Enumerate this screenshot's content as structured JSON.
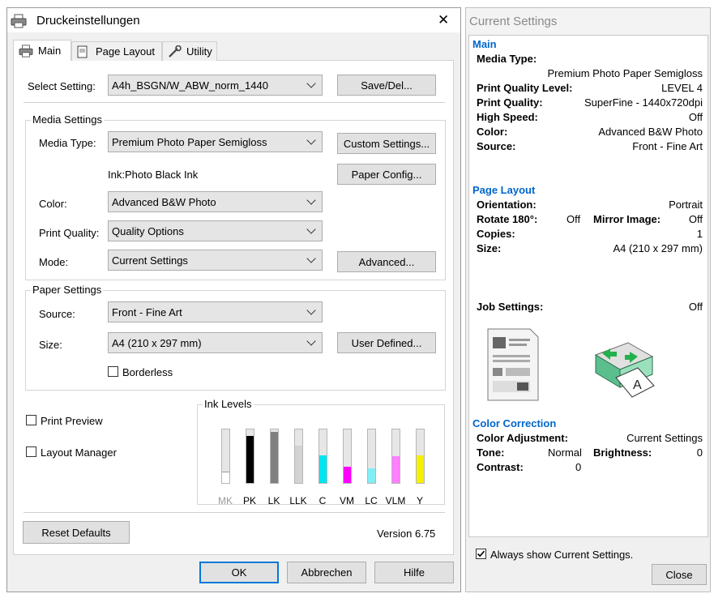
{
  "dialog": {
    "title": "Druckeinstellungen",
    "tabs": [
      "Main",
      "Page Layout",
      "Utility"
    ],
    "select_setting": {
      "label": "Select Setting:",
      "value": "A4h_BSGN/W_ABW_norm_1440",
      "button": "Save/Del..."
    },
    "media_settings": {
      "title": "Media Settings",
      "media_type": {
        "label": "Media Type:",
        "value": "Premium Photo Paper Semigloss",
        "button": "Custom Settings..."
      },
      "ink": {
        "label": "Ink:Photo Black Ink",
        "button": "Paper Config..."
      },
      "color": {
        "label": "Color:",
        "value": "Advanced B&W Photo"
      },
      "print_quality": {
        "label": "Print Quality:",
        "value": "Quality Options"
      },
      "mode": {
        "label": "Mode:",
        "value": "Current Settings",
        "button": "Advanced..."
      }
    },
    "paper_settings": {
      "title": "Paper Settings",
      "source": {
        "label": "Source:",
        "value": "Front - Fine Art"
      },
      "size": {
        "label": "Size:",
        "value": "A4 (210 x 297 mm)",
        "button": "User Defined..."
      },
      "borderless": {
        "label": "Borderless",
        "checked": false
      }
    },
    "print_preview": {
      "label": "Print Preview",
      "checked": false
    },
    "layout_manager": {
      "label": "Layout Manager",
      "checked": false
    },
    "ink_levels": {
      "title": "Ink Levels",
      "inks": [
        {
          "name": "MK",
          "level": 0.2,
          "color": "#ffffff",
          "dim": true
        },
        {
          "name": "PK",
          "level": 0.88,
          "color": "#000000"
        },
        {
          "name": "LK",
          "level": 0.95,
          "color": "#808080"
        },
        {
          "name": "LLK",
          "level": 0.7,
          "color": "#d3d3d3"
        },
        {
          "name": "C",
          "level": 0.52,
          "color": "#00e5f0"
        },
        {
          "name": "VM",
          "level": 0.3,
          "color": "#ff00ff"
        },
        {
          "name": "LC",
          "level": 0.28,
          "color": "#7feef5"
        },
        {
          "name": "VLM",
          "level": 0.5,
          "color": "#ff7fff"
        },
        {
          "name": "Y",
          "level": 0.52,
          "color": "#f5f000"
        }
      ]
    },
    "reset_button": "Reset Defaults",
    "version": "Version 6.75",
    "ok": "OK",
    "cancel": "Abbrechen",
    "help": "Hilfe",
    "close_glyph": "✕"
  },
  "current_settings": {
    "title": "Current Settings",
    "main": {
      "heading": "Main",
      "media_type_key": "Media Type:",
      "media_type_val": "Premium Photo Paper Semigloss",
      "rows": [
        {
          "key": "Print Quality Level:",
          "val": "LEVEL 4"
        },
        {
          "key": "Print Quality:",
          "val": "SuperFine - 1440x720dpi"
        },
        {
          "key": "High Speed:",
          "val": "Off"
        },
        {
          "key": "Color:",
          "val": "Advanced B&W Photo"
        },
        {
          "key": "Source:",
          "val": "Front - Fine Art"
        }
      ]
    },
    "page_layout": {
      "heading": "Page Layout",
      "orientation_key": "Orientation:",
      "orientation_val": "Portrait",
      "rotate_key": "Rotate 180°:",
      "rotate_val": "Off",
      "mirror_key": "Mirror Image:",
      "mirror_val": "Off",
      "copies_key": "Copies:",
      "copies_val": "1",
      "size_key": "Size:",
      "size_val": "A4 (210 x 297 mm)"
    },
    "job_settings": {
      "key": "Job Settings:",
      "val": "Off"
    },
    "color_correction": {
      "heading": "Color Correction",
      "adjust_key": "Color Adjustment:",
      "adjust_val": "Current Settings",
      "tone_key": "Tone:",
      "tone_val": "Normal",
      "brightness_key": "Brightness:",
      "brightness_val": "0",
      "contrast_key": "Contrast:",
      "contrast_val": "0"
    },
    "always_show": {
      "label": "Always show Current Settings.",
      "checked": true
    },
    "close": "Close"
  }
}
